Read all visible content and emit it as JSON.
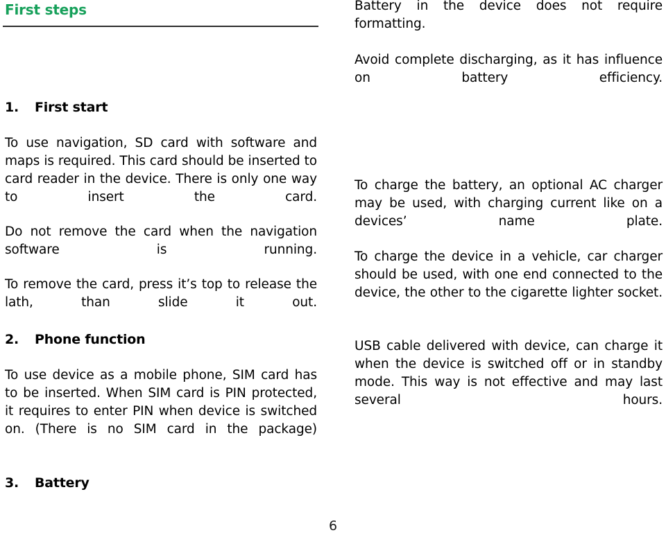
{
  "document": {
    "header_title": "First steps",
    "accent_color": "#16a05a",
    "rule_color": "#2b2b2b",
    "page_number": "6"
  },
  "left_column": {
    "sections": [
      {
        "number": "1.",
        "title": "First start"
      },
      {
        "number": "2.",
        "title": "Phone function"
      },
      {
        "number": "3.",
        "title": "Battery"
      }
    ],
    "paragraphs": [
      "To use navigation, SD card with software and maps is required. This card should be inserted to card reader in the device. There is only one way to insert the card.",
      "Do not remove the card when the navigation software is running.",
      "To remove the card, press it’s top to release the lath, than slide it out.",
      "To use device as a mobile phone, SIM card has to be inserted. When SIM card is PIN protected, it requires to enter PIN when device is switched on. (There is no SIM card in the package)"
    ]
  },
  "right_column": {
    "paragraphs": [
      "Battery in the device does not require formatting.",
      "Avoid complete discharging, as it has influence on battery efficiency.",
      "To charge the battery, an optional AC charger may be used, with charging current like on a devices’ name plate.",
      "To charge the device in a vehicle, car charger should be used, with one end connected to the device, the other to the cigarette lighter socket.",
      "USB cable delivered with device, can charge it when the device is switched off or in standby mode. This way is not effective and may last several hours."
    ]
  }
}
